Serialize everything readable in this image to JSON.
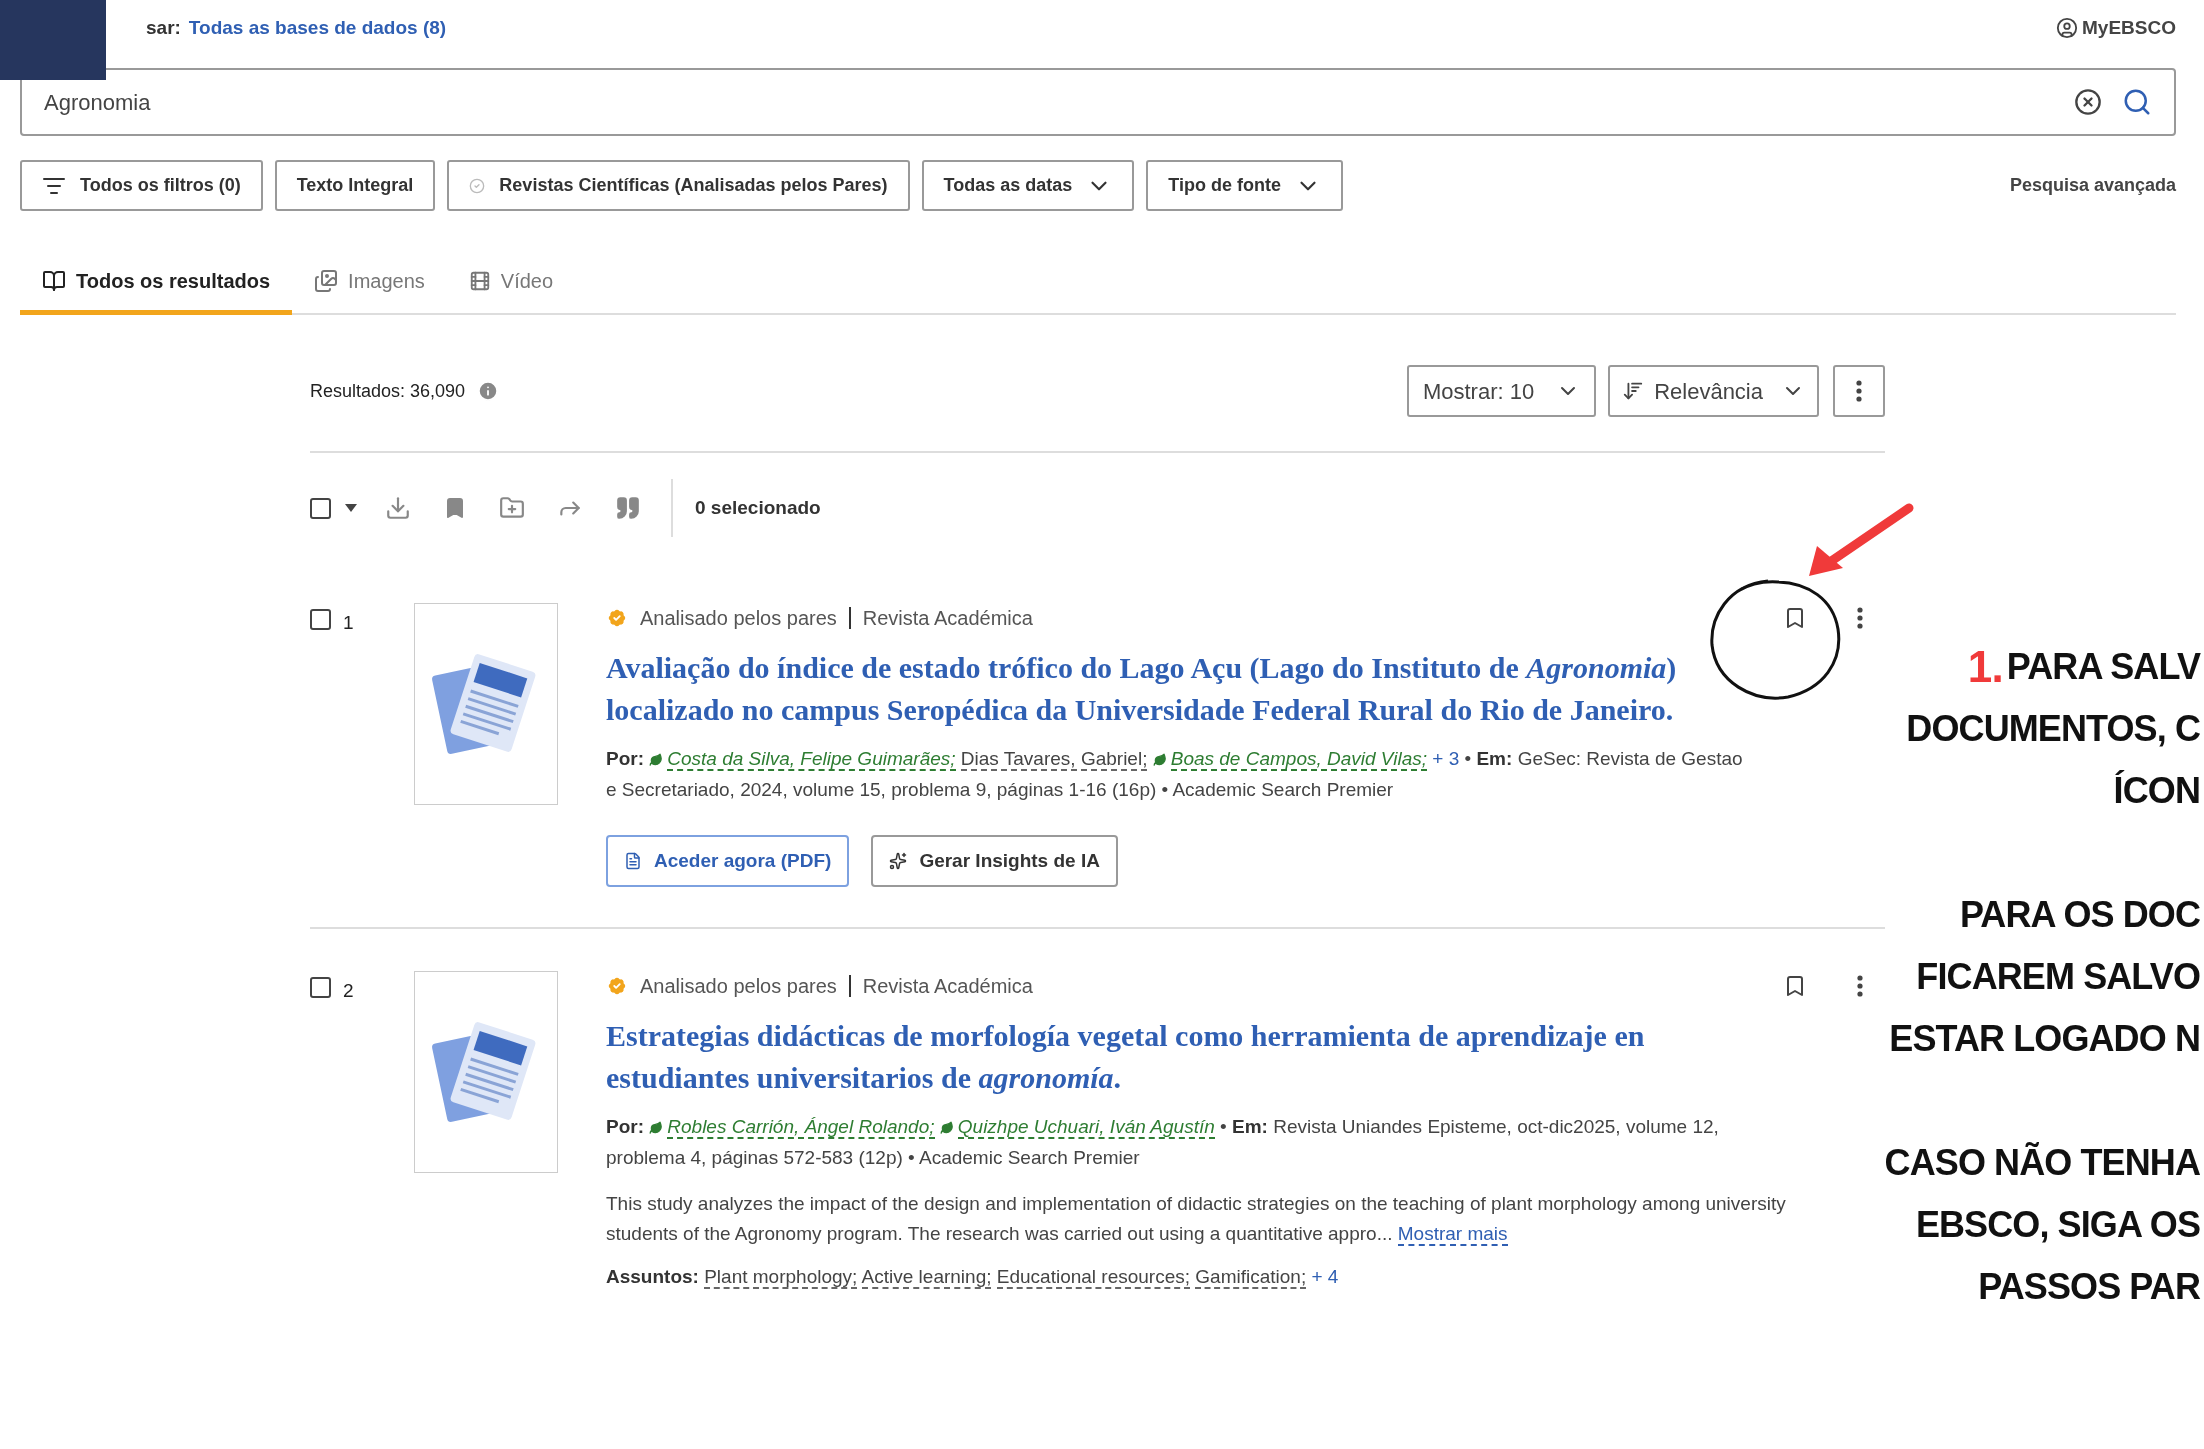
{
  "search_scope": {
    "label": "sar:",
    "value": "Todas as bases de dados (8)"
  },
  "account": "MyEBSCO",
  "search": {
    "value": "Agronomia"
  },
  "filters": [
    {
      "label": "Todos os filtros (0)",
      "kind": "filter"
    },
    {
      "label": "Texto Integral",
      "kind": "plain"
    },
    {
      "label": "Revistas Científicas (Analisadas pelos Pares)",
      "kind": "check"
    },
    {
      "label": "Todas as datas",
      "kind": "dropdown"
    },
    {
      "label": "Tipo de fonte",
      "kind": "dropdown"
    }
  ],
  "advanced_search": "Pesquisa avançada",
  "tabs": [
    {
      "label": "Todos os resultados",
      "kind": "book",
      "selected": true
    },
    {
      "label": "Imagens",
      "kind": "images",
      "selected": false
    },
    {
      "label": "Vídeo",
      "kind": "video",
      "selected": false
    }
  ],
  "results_count": "Resultados: 36,090",
  "show": "Mostrar: 10",
  "sort": "Relevância",
  "selection": {
    "checked": false,
    "count": "0 selecionado"
  },
  "results": [
    {
      "number": "1",
      "checked": false,
      "badge": "Analisado pelos pares",
      "type": "Revista Académica",
      "title": "Avaliação do índice de estado trófico do Lago Açu (Lago do Instituto de *Agronomia*) localizado no campus Seropédica da Universidade Federal Rural do Rio de Janeiro.",
      "by_label": "Por:",
      "authors": [
        {
          "name": "Costa da Silva, Felipe Guimarães;",
          "kind": "linked"
        },
        {
          "name": "Dias Tavares, Gabriel;",
          "kind": "plain"
        },
        {
          "name": "Boas de Campos, David Vilas;",
          "kind": "linked"
        }
      ],
      "more_authors": "+ 3",
      "separator": "•",
      "in_label": "Em:",
      "source": "GeSec: Revista de Gestao e Secretariado, 2024, volume 15, problema 9, páginas 1-16 (16p) • Academic Search Premier",
      "buttons": [
        {
          "label": "Aceder agora (PDF)",
          "kind": "pdf"
        },
        {
          "label": "Gerar Insights de IA",
          "kind": "ai"
        }
      ]
    },
    {
      "number": "2",
      "checked": false,
      "badge": "Analisado pelos pares",
      "type": "Revista Académica",
      "title": "Estrategias didácticas de morfología vegetal como herramienta de aprendizaje en estudiantes universitarios de *agronomía*.",
      "by_label": "Por:",
      "authors": [
        {
          "name": "Robles Carrión, Ángel Rolando;",
          "kind": "linked"
        },
        {
          "name": "Quizhpe Uchuari, Iván Agustín",
          "kind": "linked"
        }
      ],
      "separator": "•",
      "in_label": "Em:",
      "source": "Revista Uniandes Episteme, oct-dic2025, volume 12, problema 4, páginas 572-583 (12p) • Academic Search Premier",
      "abstract": "This study analyzes the impact of the design and implementation of didactic strategies on the teaching of plant morphology among university students of the Agronomy program. The research was carried out using a quantitative appro...",
      "more": "Mostrar mais",
      "subjects_label": "Assuntos:",
      "subjects": [
        "Plant morphology;",
        "Active learning;",
        "Educational resources;",
        "Gamification;"
      ],
      "more_subjects": "+ 4"
    }
  ],
  "annotation": {
    "number": "1.",
    "blocks": [
      [
        "PARA SALV",
        "DOCUMENTOS, C",
        "ÍCON"
      ],
      [
        "PARA OS DOC",
        "FICAREM SALVO",
        "ESTAR LOGADO N"
      ],
      [
        "CASO NÃO TENHA",
        "EBSCO, SIGA OS",
        "PASSOS PAR"
      ]
    ]
  }
}
